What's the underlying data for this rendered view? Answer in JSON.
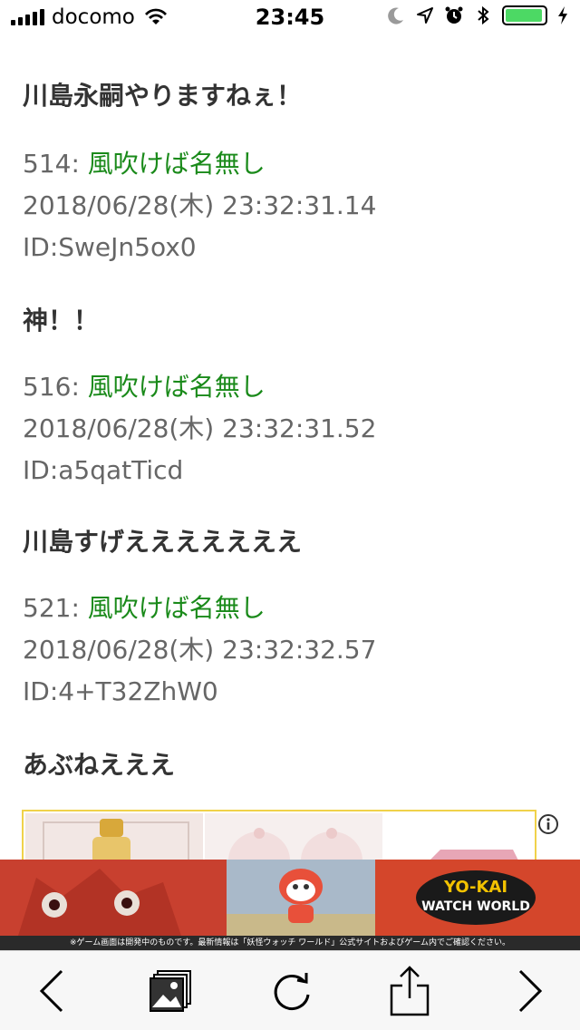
{
  "status_bar": {
    "carrier": "docomo",
    "time": "23:45",
    "battery_level": 0.95,
    "icons": [
      "signal-icon",
      "wifi-icon",
      "moon-icon",
      "location-icon",
      "alarm-icon",
      "bluetooth-icon",
      "battery-icon",
      "charging-icon"
    ]
  },
  "posts": [
    {
      "body": "川島永嗣やりますねぇ！"
    },
    {
      "number": "514:",
      "name": "風吹けば名無し",
      "date": "2018/06/28(木) 23:32:31.14",
      "id": "ID:SweJn5ox0",
      "body": "神！！"
    },
    {
      "number": "516:",
      "name": "風吹けば名無し",
      "date": "2018/06/28(木) 23:32:31.52",
      "id": "ID:a5qatTicd",
      "body": "川島すげえええええええ"
    },
    {
      "number": "521:",
      "name": "風吹けば名無し",
      "date": "2018/06/28(木) 23:32:32.57",
      "id": "ID:4+T32ZhW0",
      "body": "あぶねえええ"
    }
  ],
  "banner": {
    "logo_text": "YO-KAI WATCH WORLD",
    "caption": "※ゲーム画面は開発中のものです。最新情報は「妖怪ウォッチ ワールド」公式サイトおよびゲーム内でご確認ください。"
  },
  "toolbar": {
    "icons": [
      "back-icon",
      "tabs-icon",
      "reload-icon",
      "share-icon",
      "forward-icon"
    ]
  },
  "colors": {
    "name_green": "#1a8a1a",
    "battery_green": "#4cd964",
    "ad_border": "#f0d24a"
  }
}
